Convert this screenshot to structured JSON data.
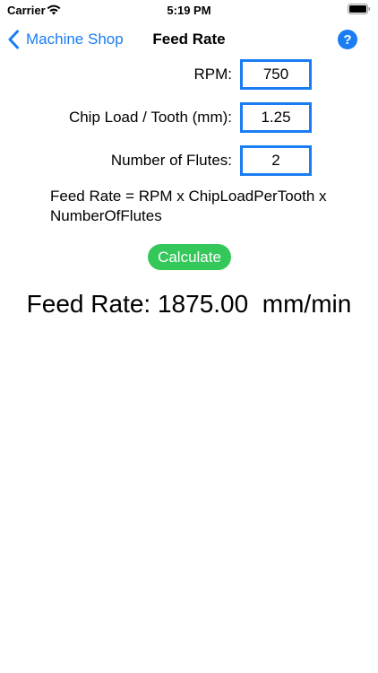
{
  "status_bar": {
    "carrier": "Carrier",
    "time": "5:19 PM"
  },
  "nav": {
    "back_label": "Machine Shop",
    "title": "Feed Rate",
    "help_label": "?"
  },
  "form": {
    "rpm": {
      "label": "RPM:",
      "value": "750"
    },
    "chip_load": {
      "label": "Chip Load / Tooth (mm):",
      "value": "1.25"
    },
    "flutes": {
      "label": "Number of Flutes:",
      "value": "2"
    }
  },
  "formula": "Feed Rate = RPM x ChipLoadPerTooth x NumberOfFlutes",
  "calculate_label": "Calculate",
  "result": {
    "label": "Feed Rate:",
    "value": "1875.00",
    "unit": "mm/min"
  },
  "colors": {
    "accent": "#1b7cf3",
    "button_green": "#34c759"
  }
}
